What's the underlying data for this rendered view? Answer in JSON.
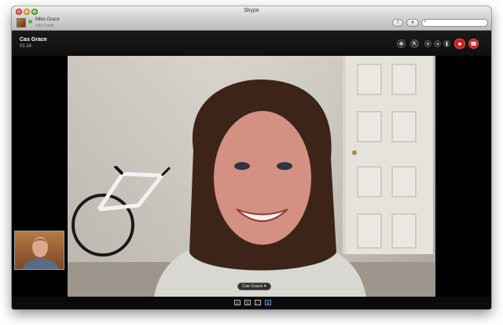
{
  "window": {
    "title": "Skype"
  },
  "profile": {
    "name": "Mike Grace",
    "mood": "Add Credit"
  },
  "toolbar": {
    "help_label": "?",
    "dropdown_label": "▾"
  },
  "search": {
    "placeholder": ""
  },
  "call": {
    "contact_name": "Cas Grace",
    "duration": "01:14",
    "name_tag": "Cas Grace ▾"
  },
  "colors": {
    "hangup": "#c8221b",
    "accent": "#5b9bd8"
  },
  "controls": [
    "full-view-icon",
    "popout-icon",
    "mic-icon",
    "speaker-icon",
    "pause-icon",
    "video-icon",
    "hangup-icon"
  ],
  "view_modes": [
    "single-view-icon",
    "split-view-icon",
    "fullscreen-icon",
    "grid-view-icon"
  ]
}
